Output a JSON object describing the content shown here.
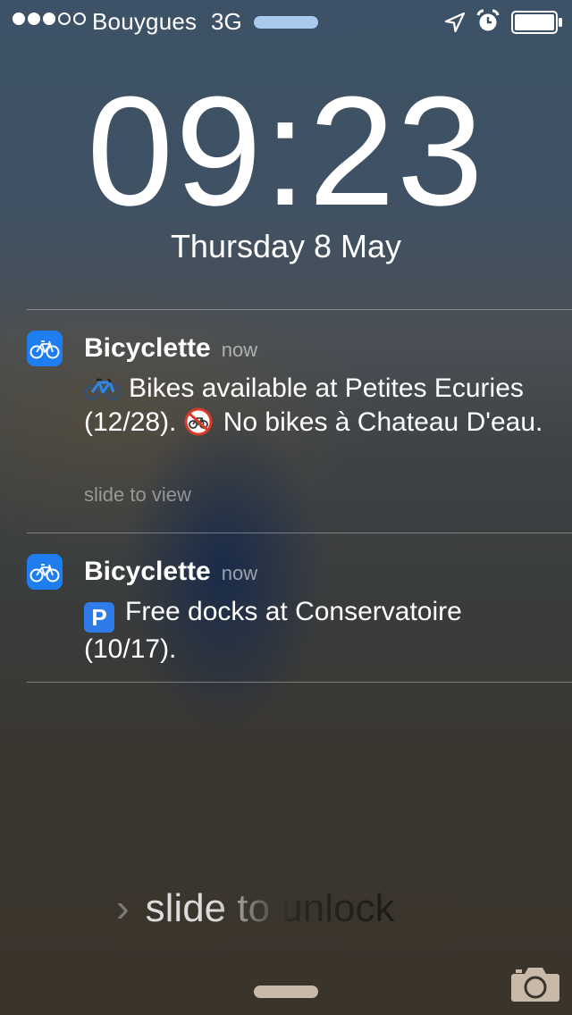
{
  "status_bar": {
    "signal_bars_filled": 3,
    "signal_bars_total": 5,
    "carrier": "Bouygues",
    "network": "3G",
    "icons": [
      "location-arrow-icon",
      "alarm-clock-icon",
      "battery-icon"
    ],
    "battery_level": 1.0,
    "loading_color": "#a9c9ee"
  },
  "lock": {
    "time": "09:23",
    "date": "Thursday 8 May"
  },
  "notifications": [
    {
      "app": "Bicyclette",
      "time": "now",
      "icon": "bicycle-icon",
      "emoji_1": "bike-emoji",
      "message_part1": "Bikes available at Petites Ecuries (12/28).",
      "emoji_2": "no-bicycles-emoji",
      "message_part2": "No bikes à Chateau D'eau.",
      "action_hint": "slide to view"
    },
    {
      "app": "Bicyclette",
      "time": "now",
      "icon": "bicycle-icon",
      "emoji_1": "parking-emoji",
      "emoji_1_text": "P",
      "message_part1": "Free docks at Conservatoire (10/17)."
    }
  ],
  "unlock": {
    "chevron": "›",
    "label": "slide to unlock"
  },
  "accent_color": "#1e7ef0"
}
